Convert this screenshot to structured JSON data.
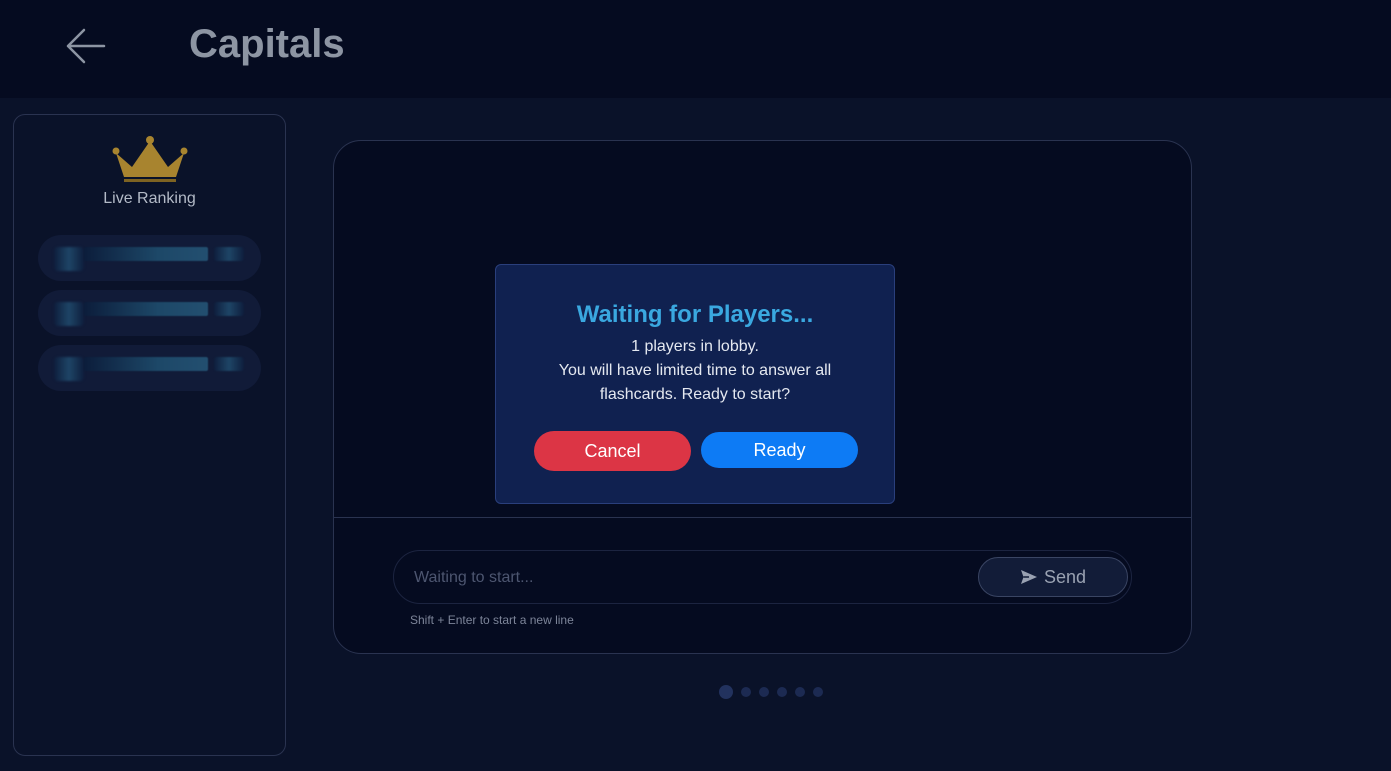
{
  "header": {
    "title": "Capitals",
    "back_icon": "arrow-left-icon"
  },
  "sidebar": {
    "crown_icon": "crown-icon",
    "crown_color": "#a8842f",
    "title": "Live Ranking"
  },
  "modal": {
    "title": "Waiting for Players...",
    "line1": "1 players in lobby.",
    "line2": "You will have limited time to answer all flashcards. Ready to start?",
    "cancel_label": "Cancel",
    "ready_label": "Ready"
  },
  "chat": {
    "placeholder": "Waiting to start...",
    "send_label": "Send",
    "send_icon": "send-icon",
    "hint": "Shift + Enter to start a new line"
  },
  "pagination": {
    "total": 6,
    "current": 1
  },
  "colors": {
    "background": "#0a1229",
    "header": "#050b20",
    "modal": "#102150",
    "accent_title": "#3aa8e0",
    "cancel": "#dc3545",
    "ready": "#0d7bf5"
  }
}
